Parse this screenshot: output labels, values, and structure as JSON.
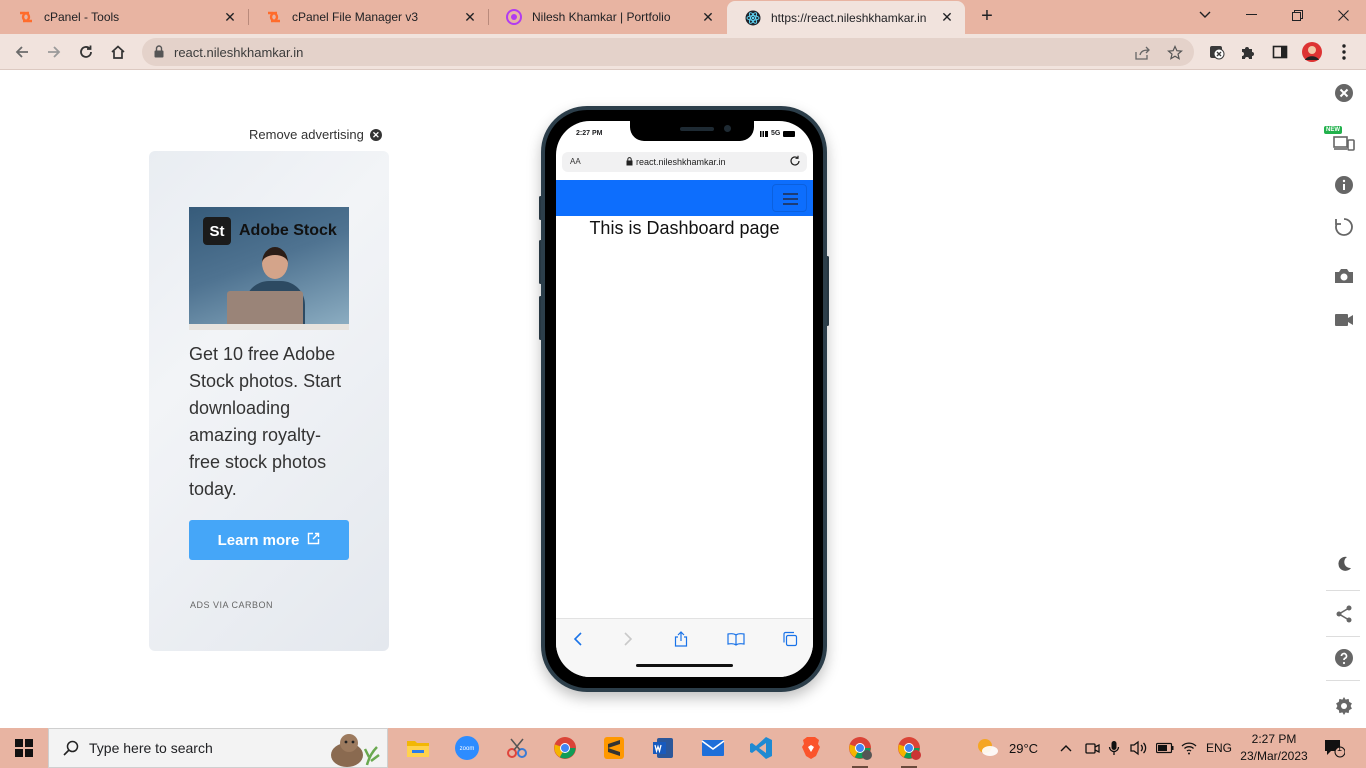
{
  "browser": {
    "tabs": [
      {
        "title": "cPanel - Tools",
        "icon": "cpanel-icon",
        "active": false
      },
      {
        "title": "cPanel File Manager v3",
        "icon": "cpanel-icon",
        "active": false
      },
      {
        "title": "Nilesh Khamkar | Portfolio",
        "icon": "portfolio-icon",
        "active": false
      },
      {
        "title": "https://react.nileshkhamkar.in",
        "icon": "react-icon",
        "active": true
      }
    ],
    "new_tab": "+",
    "address": "react.nileshkhamkar.in"
  },
  "ad": {
    "remove_label": "Remove advertising",
    "brand_badge": "St",
    "brand_name": "Adobe Stock",
    "text": "Get 10 free Adobe Stock photos. Start downloading amazing royalty-free stock photos today.",
    "button_label": "Learn more",
    "via": "ADS VIA CARBON"
  },
  "phone": {
    "time": "2:27 PM",
    "network": "5G",
    "aa": "AA",
    "url": "react.nileshkhamkar.in",
    "heading": "This is Dashboard page"
  },
  "rail": {
    "new_badge": "NEW"
  },
  "taskbar": {
    "search_placeholder": "Type here to search",
    "zoom_label": "zoom",
    "weather": "29°C",
    "lang": "ENG",
    "time": "2:27 PM",
    "date": "23/Mar/2023",
    "notifications": "1"
  },
  "colors": {
    "chrome_frame": "#e8b4a2",
    "toolbar": "#f1e3dd",
    "navbar": "#0d6efd",
    "learn_button": "#45a6f8"
  }
}
